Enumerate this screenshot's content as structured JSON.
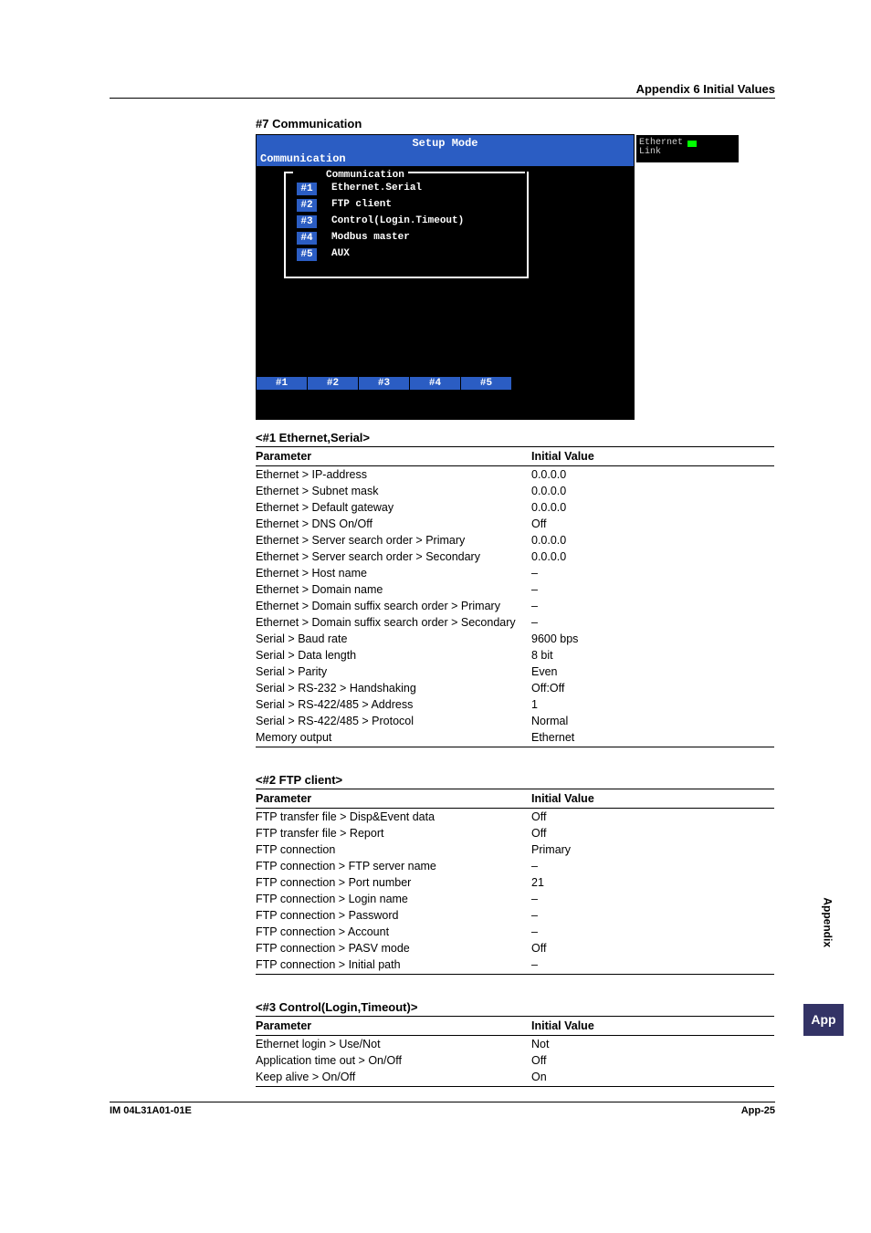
{
  "header": {
    "title": "Appendix 6  Initial Values"
  },
  "section_title": "#7 Communication",
  "setup_mode": {
    "title": "Setup Mode",
    "subtitle_bar": "Communication",
    "legend": "Communication",
    "ethernet_link_label": "Ethernet\nLink",
    "items": [
      {
        "num": "#1",
        "label": "Ethernet.Serial"
      },
      {
        "num": "#2",
        "label": "FTP client"
      },
      {
        "num": "#3",
        "label": "Control(Login.Timeout)"
      },
      {
        "num": "#4",
        "label": "Modbus master"
      },
      {
        "num": "#5",
        "label": "AUX"
      }
    ],
    "tabs": [
      "#1",
      "#2",
      "#3",
      "#4",
      "#5"
    ]
  },
  "tables": [
    {
      "title": "<#1 Ethernet,Serial>",
      "col1": "Parameter",
      "col2": "Initial Value",
      "rows": [
        {
          "p": "Ethernet > IP-address",
          "v": "0.0.0.0"
        },
        {
          "p": "Ethernet > Subnet mask",
          "v": "0.0.0.0"
        },
        {
          "p": "Ethernet > Default gateway",
          "v": "0.0.0.0"
        },
        {
          "p": "Ethernet > DNS On/Off",
          "v": "Off"
        },
        {
          "p": "Ethernet > Server search order > Primary",
          "v": "0.0.0.0"
        },
        {
          "p": "Ethernet > Server search order > Secondary",
          "v": "0.0.0.0"
        },
        {
          "p": "Ethernet > Host name",
          "v": "–"
        },
        {
          "p": "Ethernet > Domain name",
          "v": "–"
        },
        {
          "p": "Ethernet > Domain suffix search order > Primary",
          "v": "–"
        },
        {
          "p": "Ethernet > Domain suffix search order > Secondary",
          "v": "–"
        },
        {
          "p": "Serial > Baud rate",
          "v": "9600 bps"
        },
        {
          "p": "Serial > Data length",
          "v": "8 bit"
        },
        {
          "p": "Serial > Parity",
          "v": "Even"
        },
        {
          "p": "Serial > RS-232 > Handshaking",
          "v": "Off:Off"
        },
        {
          "p": "Serial > RS-422/485 > Address",
          "v": "1"
        },
        {
          "p": "Serial > RS-422/485 > Protocol",
          "v": "Normal"
        },
        {
          "p": "Memory output",
          "v": "Ethernet"
        }
      ]
    },
    {
      "title": "<#2 FTP client>",
      "col1": "Parameter",
      "col2": "Initial Value",
      "rows": [
        {
          "p": "FTP transfer file > Disp&Event data",
          "v": "Off"
        },
        {
          "p": "FTP transfer file > Report",
          "v": "Off"
        },
        {
          "p": "FTP connection",
          "v": "Primary"
        },
        {
          "p": "FTP connection > FTP server name",
          "v": "–"
        },
        {
          "p": "FTP connection > Port number",
          "v": "21"
        },
        {
          "p": "FTP connection > Login name",
          "v": "–"
        },
        {
          "p": "FTP connection > Password",
          "v": "–"
        },
        {
          "p": "FTP connection > Account",
          "v": "–"
        },
        {
          "p": "FTP connection > PASV mode",
          "v": "Off"
        },
        {
          "p": "FTP connection > Initial path",
          "v": "–"
        }
      ]
    },
    {
      "title": "<#3 Control(Login,Timeout)>",
      "col1": "Parameter",
      "col2": "Initial Value",
      "rows": [
        {
          "p": "Ethernet login > Use/Not",
          "v": "Not"
        },
        {
          "p": "Application time out > On/Off",
          "v": "Off"
        },
        {
          "p": "Keep alive > On/Off",
          "v": "On"
        }
      ]
    }
  ],
  "footer": {
    "doc_id": "IM 04L31A01-01E",
    "page_num": "App-25"
  },
  "side": {
    "tab": "App",
    "label": "Appendix"
  }
}
